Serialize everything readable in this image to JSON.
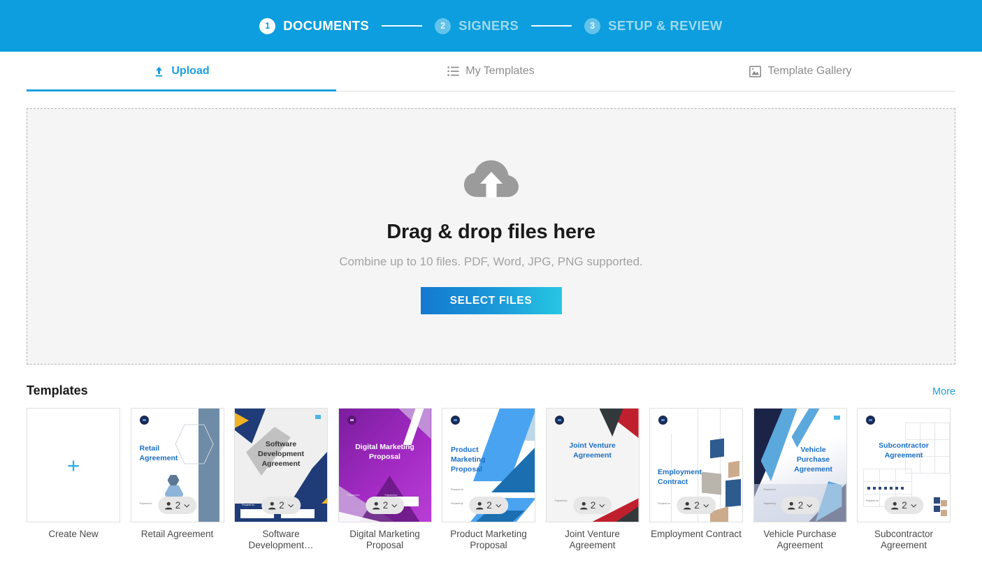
{
  "stepper": {
    "steps": [
      {
        "number": "1",
        "label": "DOCUMENTS",
        "state": "active"
      },
      {
        "number": "2",
        "label": "SIGNERS",
        "state": "inactive"
      },
      {
        "number": "3",
        "label": "SETUP & REVIEW",
        "state": "inactive"
      }
    ]
  },
  "tabs": [
    {
      "label": "Upload",
      "icon": "upload-icon",
      "active": true
    },
    {
      "label": "My Templates",
      "icon": "list-icon",
      "active": false
    },
    {
      "label": "Template Gallery",
      "icon": "image-icon",
      "active": false
    }
  ],
  "dropzone": {
    "icon": "cloud-upload-icon",
    "title": "Drag & drop files here",
    "subtitle": "Combine up to 10 files. PDF, Word, JPG, PNG supported.",
    "button_label": "SELECT FILES"
  },
  "templates_section": {
    "title": "Templates",
    "more_label": "More"
  },
  "templates": [
    {
      "label": "Create New",
      "kind": "create-new"
    },
    {
      "label": "Retail Agreement",
      "thumb_title": "Retail\nAgreement",
      "signers": "2",
      "prepared_for": "Prepared for:",
      "prepared_by": "Prepared by:"
    },
    {
      "label": "Software Development…",
      "thumb_title": "Software\nDevelopment\nAgreement",
      "signers": "2",
      "prepared_for": "Prepared for:",
      "prepared_by": "Prepared by:"
    },
    {
      "label": "Digital Marketing Proposal",
      "thumb_title": "Digital Marketing\nProposal",
      "signers": "2",
      "prepared_for": "Prepared for:",
      "prepared_by": "Prepared by:"
    },
    {
      "label": "Product Marketing Proposal",
      "thumb_title": "Product\nMarketing\nProposal",
      "signers": "2",
      "prepared_for": "Prepared for:",
      "prepared_by": "Prepared by:"
    },
    {
      "label": "Joint Venture Agreement",
      "thumb_title": "Joint Venture\nAgreement",
      "signers": "2",
      "prepared_for": "Prepared for:",
      "prepared_by": "Prepared by:"
    },
    {
      "label": "Employment Contract",
      "thumb_title": "Employment\nContract",
      "signers": "2",
      "prepared_for": "Prepared for:",
      "prepared_by": "Prepared by:"
    },
    {
      "label": "Vehicle Purchase Agreement",
      "thumb_title": "Vehicle\nPurchase\nAgreement",
      "signers": "2",
      "prepared_for": "Prepared for:",
      "prepared_by": "Prepared by:"
    },
    {
      "label": "Subcontractor Agreement",
      "thumb_title": "Subcontractor\nAgreement",
      "signers": "2",
      "prepared_for": "Prepared for:",
      "prepared_by": "Prepared by:"
    }
  ],
  "colors": {
    "header_blue": "#0c9ede",
    "accent_blue": "#1b9fe0",
    "button_gradient_start": "#1379cf",
    "button_gradient_end": "#27c7e3",
    "dropzone_bg": "#f5f5f5",
    "badge_bg": "#e6e6e6"
  }
}
